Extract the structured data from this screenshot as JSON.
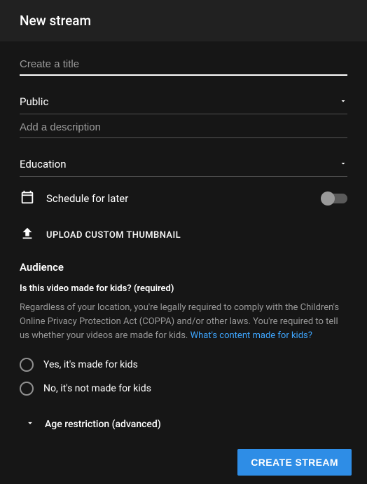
{
  "header": {
    "title": "New stream"
  },
  "title_field": {
    "placeholder": "Create a title",
    "value": ""
  },
  "visibility": {
    "selected": "Public"
  },
  "description": {
    "placeholder": "Add a description",
    "value": ""
  },
  "category": {
    "selected": "Education"
  },
  "schedule": {
    "label": "Schedule for later",
    "enabled": false
  },
  "upload": {
    "label": "UPLOAD CUSTOM THUMBNAIL"
  },
  "audience": {
    "heading": "Audience",
    "question": "Is this video made for kids? (required)",
    "disclaimer": "Regardless of your location, you're legally required to comply with the Children's Online Privacy Protection Act (COPPA) and/or other laws. You're required to tell us whether your videos are made for kids. ",
    "link_text": "What's content made for kids?",
    "options": [
      {
        "label": "Yes, it's made for kids"
      },
      {
        "label": "No, it's not made for kids"
      }
    ],
    "advanced_label": "Age restriction (advanced)"
  },
  "actions": {
    "primary": "CREATE STREAM"
  }
}
